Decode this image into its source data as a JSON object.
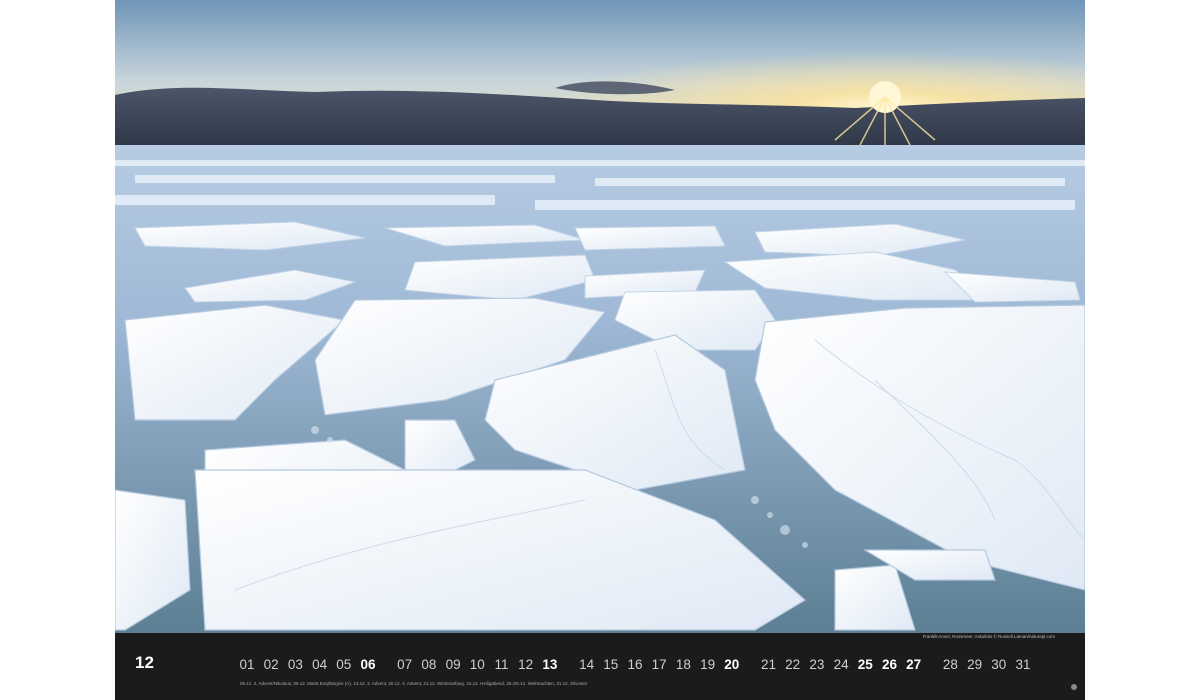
{
  "calendar": {
    "month_number": "12",
    "photo_credit": "Franklin-Insel, Rossmeer, Antarktis © Russell Laman/naturepl.com",
    "holiday_note": "06.12. 2. Advent/Nikolaus, 08.12. Mariä Empfängnis (A), 13.12. 3. Advent, 20.12. 4. Advent, 21.12. Winteranfang, 24.12. Heiligabend, 25./26.12. Weihnachten, 31.12. Silvester",
    "days": [
      {
        "label": "01",
        "bold": false
      },
      {
        "label": "02",
        "bold": false
      },
      {
        "label": "03",
        "bold": false
      },
      {
        "label": "04",
        "bold": false
      },
      {
        "label": "05",
        "bold": false
      },
      {
        "label": "06",
        "bold": true
      },
      {
        "label": "07",
        "bold": false
      },
      {
        "label": "08",
        "bold": false
      },
      {
        "label": "09",
        "bold": false
      },
      {
        "label": "10",
        "bold": false
      },
      {
        "label": "11",
        "bold": false
      },
      {
        "label": "12",
        "bold": false
      },
      {
        "label": "13",
        "bold": true
      },
      {
        "label": "14",
        "bold": false
      },
      {
        "label": "15",
        "bold": false
      },
      {
        "label": "16",
        "bold": false
      },
      {
        "label": "17",
        "bold": false
      },
      {
        "label": "18",
        "bold": false
      },
      {
        "label": "19",
        "bold": false
      },
      {
        "label": "20",
        "bold": true
      },
      {
        "label": "21",
        "bold": false
      },
      {
        "label": "22",
        "bold": false
      },
      {
        "label": "23",
        "bold": false
      },
      {
        "label": "24",
        "bold": false
      },
      {
        "label": "25",
        "bold": true
      },
      {
        "label": "26",
        "bold": true
      },
      {
        "label": "27",
        "bold": true
      },
      {
        "label": "28",
        "bold": false
      },
      {
        "label": "29",
        "bold": false
      },
      {
        "label": "30",
        "bold": false
      },
      {
        "label": "31",
        "bold": false
      }
    ]
  },
  "colors": {
    "bar_background": "#1b1b1b",
    "weekday_text": "#cfcfcf",
    "sunday_text": "#ffffff"
  }
}
